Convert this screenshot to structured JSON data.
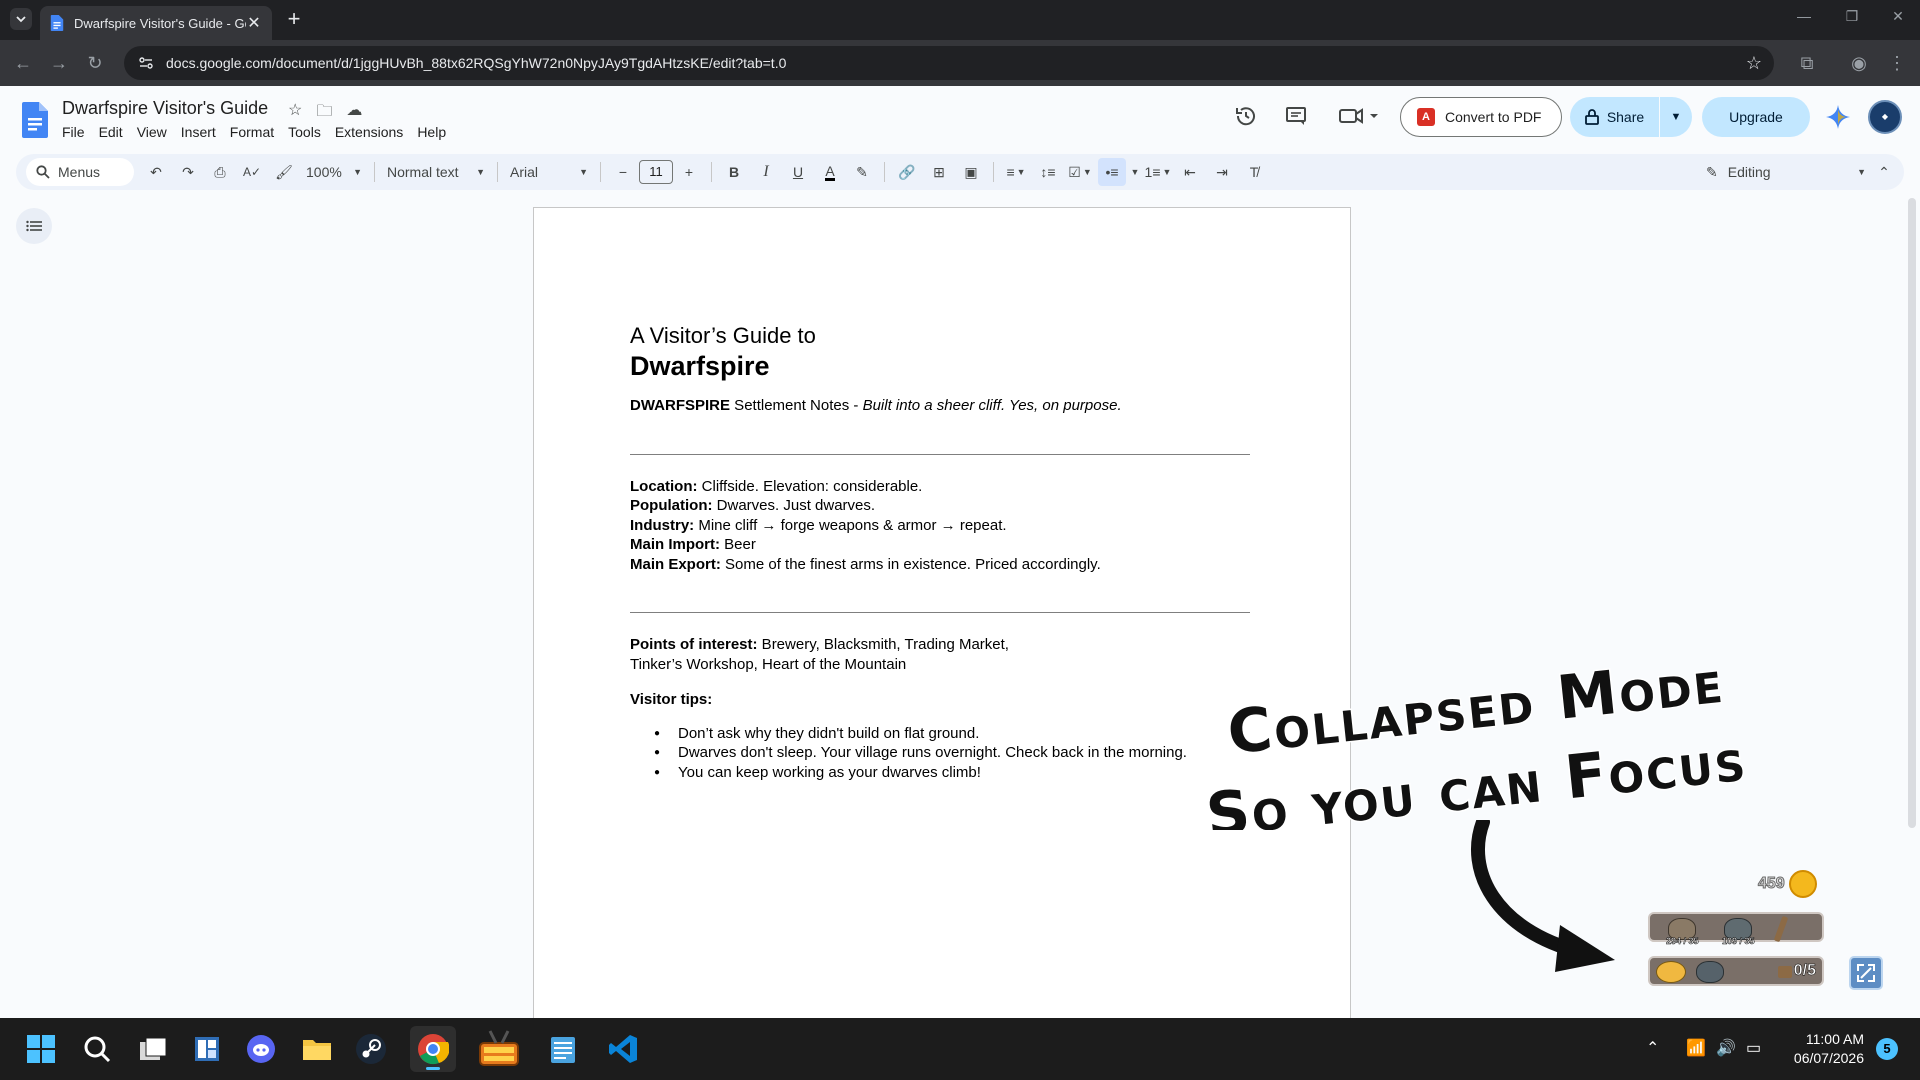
{
  "browser": {
    "tab_title": "Dwarfspire Visitor's Guide - Goo",
    "url": "docs.google.com/document/d/1jggHUvBh_88tx62RQSgYhW72n0NpyJAy9TgdAHtzsKE/edit?tab=t.0"
  },
  "docs": {
    "title": "Dwarfspire Visitor's Guide",
    "menus": [
      "File",
      "Edit",
      "View",
      "Insert",
      "Format",
      "Tools",
      "Extensions",
      "Help"
    ],
    "convert_pdf": "Convert to PDF",
    "share": "Share",
    "upgrade": "Upgrade"
  },
  "toolbar": {
    "search_label": "Menus",
    "zoom": "100%",
    "style": "Normal text",
    "font": "Arial",
    "font_size": "11",
    "mode": "Editing"
  },
  "document": {
    "subtitle": "A Visitor’s Guide to",
    "title": "Dwarfspire",
    "intro_bold": "DWARFSPIRE",
    "intro_rest": " Settlement Notes - ",
    "intro_italic": "Built into a sheer cliff. Yes, on purpose.",
    "facts": [
      {
        "label": "Location:",
        "value": " Cliffside. Elevation: considerable."
      },
      {
        "label": "Population:",
        "value": " Dwarves. Just dwarves."
      },
      {
        "label": "Industry:",
        "value": " Mine cliff → forge weapons & armor → repeat."
      },
      {
        "label": "Main Import:",
        "value": " Beer"
      },
      {
        "label": "Main Export:",
        "value": " Some of the finest arms in existence. Priced accordingly."
      }
    ],
    "poi_label": "Points of interest:",
    "poi_line1": " Brewery, Blacksmith, Trading Market,",
    "poi_line2": "Tinker’s Workshop, Heart of the Mountain",
    "tips_label": "Visitor tips:",
    "tips": [
      "Don’t ask why they didn't build on flat ground.",
      "Dwarves don't sleep. Your village runs overnight. Check back in the morning.",
      "You can keep working as your dwarves climb!"
    ]
  },
  "overlay": {
    "line1": "Collapsed Mode",
    "line2": "So you can Focus"
  },
  "hud": {
    "coins": "459",
    "stone": "294 / 35",
    "ore": "109 / 35",
    "workers": "0/5"
  },
  "taskbar": {
    "time": "11:00 AM",
    "date": "06/07/2026",
    "notifications": "5"
  }
}
